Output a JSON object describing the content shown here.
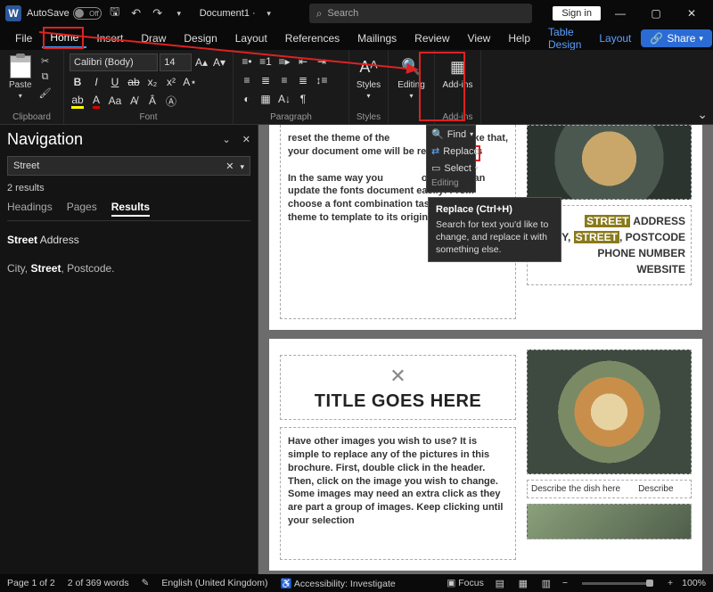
{
  "titlebar": {
    "autosave_label": "AutoSave",
    "autosave_state": "Off",
    "doc_title": "Document1 ·",
    "search_placeholder": "Search",
    "signin": "Sign in"
  },
  "menu": {
    "items": [
      "File",
      "Home",
      "Insert",
      "Draw",
      "Design",
      "Layout",
      "References",
      "Mailings",
      "Review",
      "View",
      "Help",
      "Table Design",
      "Layout"
    ],
    "active": "Home",
    "share": "Share"
  },
  "ribbon": {
    "clipboard": {
      "paste": "Paste",
      "label": "Clipboard"
    },
    "font": {
      "name": "Calibri (Body)",
      "size": "14",
      "label": "Font"
    },
    "paragraph": {
      "label": "Paragraph"
    },
    "styles": {
      "btn": "Styles",
      "label": "Styles"
    },
    "editing": {
      "btn": "Editing"
    },
    "addins": {
      "btn": "Add-ins",
      "label": "Add-ins"
    }
  },
  "editing_menu": {
    "find": "Find",
    "replace": "Replace",
    "select": "Select",
    "group": "Editing"
  },
  "tooltip": {
    "title": "Replace (Ctrl+H)",
    "body": "Search for text you'd like to change, and replace it with something else."
  },
  "nav": {
    "title": "Navigation",
    "search_value": "Street",
    "count": "2 results",
    "tabs": [
      "Headings",
      "Pages",
      "Results"
    ],
    "active_tab": "Results",
    "result1_pre": "",
    "result1_bold": "Street",
    "result1_post": " Address",
    "result2": "City, ",
    "result2_bold": "Street",
    "result2_post": ", Postcode."
  },
  "doc": {
    "p1_text1": "reset the theme of the",
    "p1_text1b": "and just like that, your document",
    "p1_text1c": "will be restored to its",
    "p1_text1d": "ome",
    "p1_text2a": "In the same way you",
    "p1_text2b": "ours, you can update the fonts",
    "p1_text2c": "document easily! From",
    "p1_text2d": "choose a font combination",
    "p1_text2e": "taste. Reset the theme to",
    "p1_text2f": "template to its original state!",
    "addr_street": "STREET",
    "addr_line1": " ADDRESS",
    "addr_line2a": "CITY, ",
    "addr_line2b": "STREET",
    "addr_line2c": ", POSTCODE",
    "addr_line3": "PHONE NUMBER",
    "addr_line4": "WEBSITE",
    "p2_title": "TITLE GOES HERE",
    "p2_body": "Have other images you wish to use? It is simple to replace any of the pictures in this brochure. First, double click in the header. Then, click on the image you wish to change. Some images may need an extra click as they are part a group of images. Keep clicking until your selection",
    "caption1": "Describe the dish here",
    "caption2": "Describe"
  },
  "status": {
    "page": "Page 1 of 2",
    "words": "2 of 369 words",
    "lang": "English (United Kingdom)",
    "accessibility": "Accessibility: Investigate",
    "focus": "Focus",
    "zoom": "100%"
  }
}
